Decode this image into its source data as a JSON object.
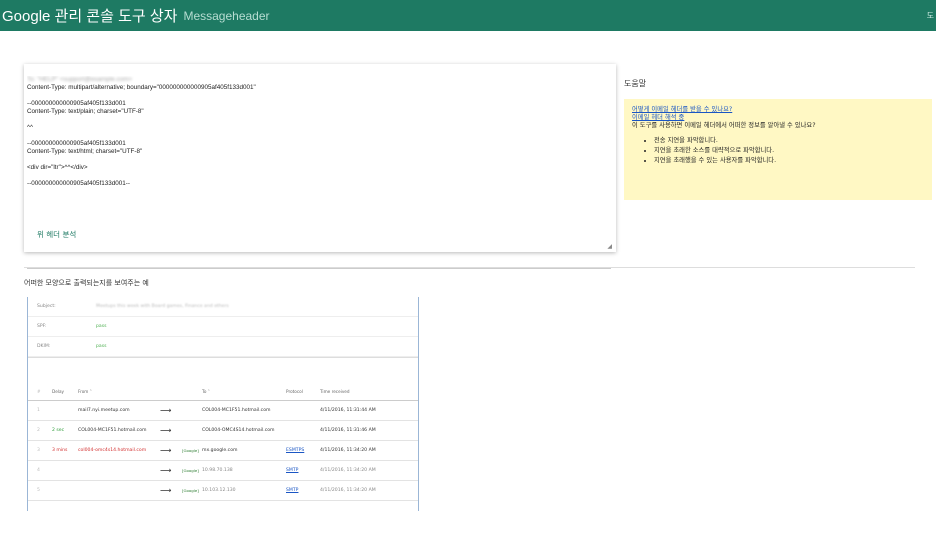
{
  "header": {
    "brand": "Google 관리 콘솔 도구 상자",
    "tool": "Messageheader",
    "corner": "도"
  },
  "editor": {
    "lines": [
      {
        "text": "To: \"HELP\" <support@example.com>",
        "blur": true
      },
      {
        "text": "Content-Type: multipart/alternative; boundary=\"000000000000905af405f133d001\""
      },
      {
        "text": ""
      },
      {
        "text": "--000000000000905af405f133d001"
      },
      {
        "text": "Content-Type: text/plain; charset=\"UTF-8\""
      },
      {
        "text": ""
      },
      {
        "text": "^^"
      },
      {
        "text": ""
      },
      {
        "text": "--000000000000905af405f133d001"
      },
      {
        "text": "Content-Type: text/html; charset=\"UTF-8\""
      },
      {
        "text": ""
      },
      {
        "text": "<div dir=\"ltr\">^^</div>"
      },
      {
        "text": ""
      },
      {
        "text": "--000000000000905af405f133d001--"
      }
    ],
    "analyze_label": "위 헤더 분석"
  },
  "help": {
    "title": "도움말",
    "link1": "어떻게 이메일 헤더를 받을 수 있나요?",
    "link2": "이메일 헤더 해석 중",
    "question": "이 도구를 사용하면 이메일 헤더에서 어떠한 정보를 알아낼 수 있나요?",
    "bullets": [
      "전송 지연을 파악합니다.",
      "지연을 초래한 소스를 대략적으로 파악합니다.",
      "지연을 초래했을 수 있는 사용자를 파악합니다."
    ]
  },
  "example": {
    "title": "어떠한 모양으로 출력되는지를 보여주는 예",
    "subject_label": "Subject:",
    "subject_value": "Meetups this week with Board games, Finance and others",
    "spf_label": "SPF:",
    "spf_value": "pass",
    "dkim_label": "DKIM:",
    "dkim_value": "pass",
    "columns": {
      "num": "#",
      "delay": "Delay",
      "from": "From ˄",
      "to": "To ˄",
      "protocol": "Protocol",
      "time": "Time received"
    },
    "rows": [
      {
        "num": "1",
        "delay": "",
        "from": "mail7.nyi.meetup.com",
        "arrow": "⟶",
        "google": "",
        "to": "COL004-MC1F51.hotmail.com",
        "protocol": "",
        "time": "4/11/2016, 11:31:44 AM"
      },
      {
        "num": "2",
        "delay": "2 sec",
        "from": "COL004-MC1F51.hotmail.com",
        "arrow": "⟶",
        "google": "",
        "to": "COL004-OMC4S14.hotmail.com",
        "protocol": "",
        "time": "4/11/2016, 11:31:46 AM"
      },
      {
        "num": "3",
        "delay": "3 mins",
        "from": "col004-omc4s14.hotmail.com",
        "arrow": "⟶",
        "google": "[Google]",
        "to": "mx.google.com",
        "protocol": "ESMTPS",
        "time": "4/11/2016, 11:34:20 AM"
      },
      {
        "num": "4",
        "delay": "",
        "from": "",
        "arrow": "⟶",
        "google": "[Google]",
        "to": "10.98.70.138",
        "protocol": "SMTP",
        "time": "4/11/2016, 11:34:20 AM"
      },
      {
        "num": "5",
        "delay": "",
        "from": "",
        "arrow": "⟶",
        "google": "[Google]",
        "to": "10.103.12.130",
        "protocol": "SMTP",
        "time": "4/11/2016, 11:34:20 AM"
      }
    ]
  }
}
